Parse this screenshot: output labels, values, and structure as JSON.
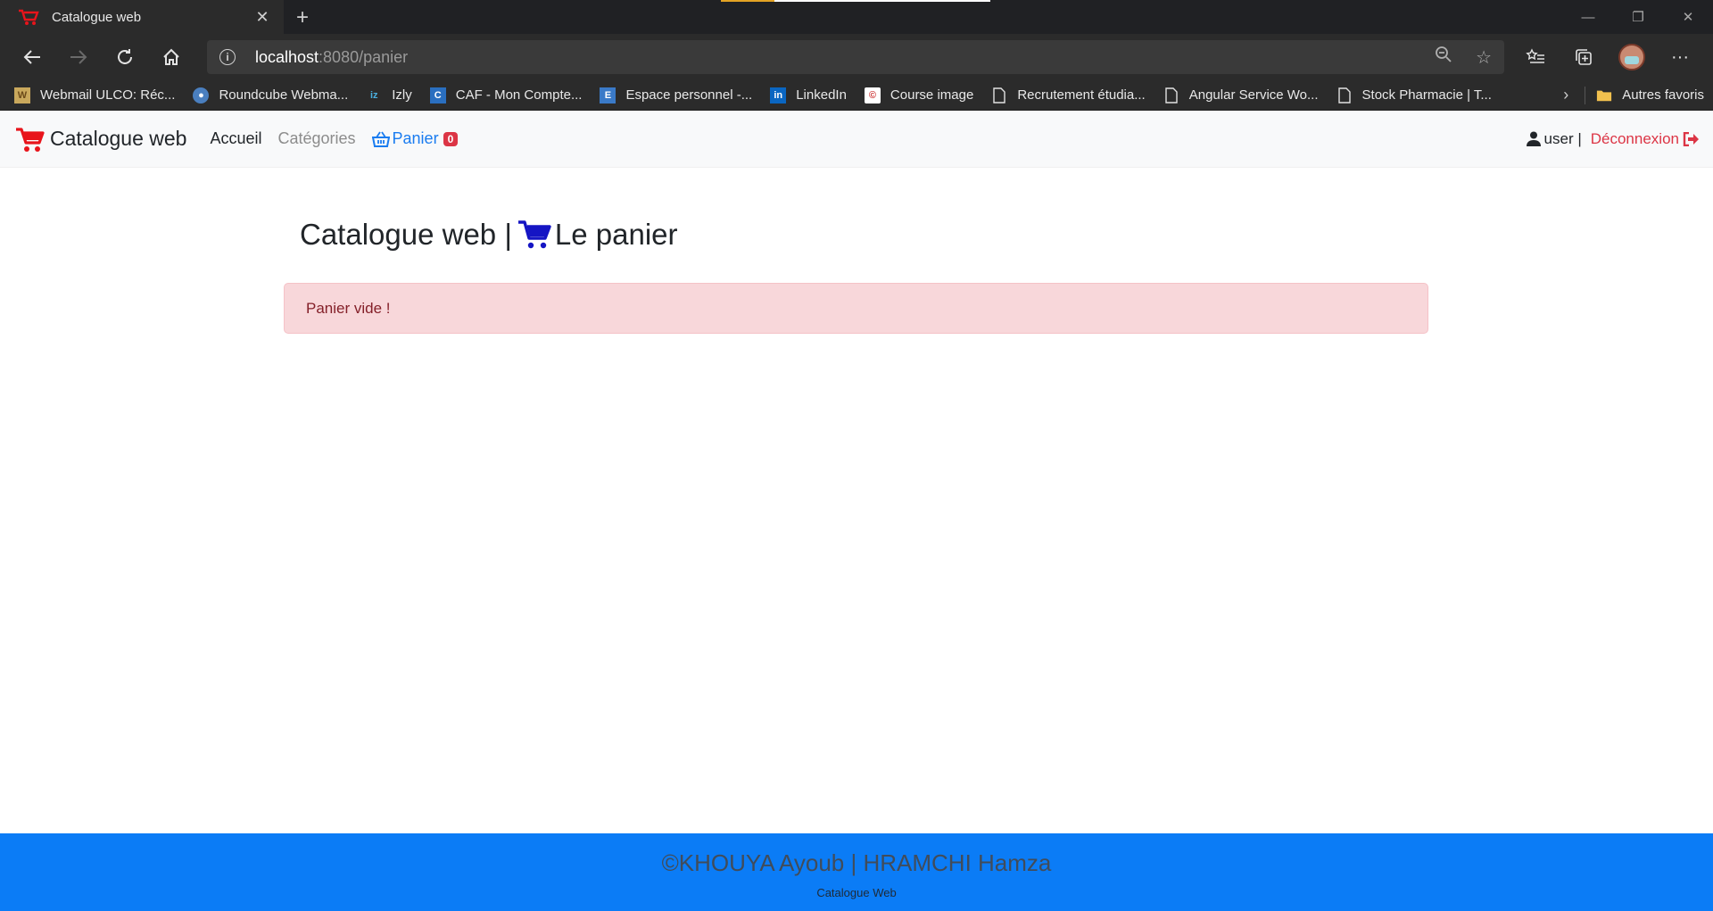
{
  "browser": {
    "tab_title": "Catalogue web",
    "url_host": "localhost",
    "url_rest": ":8080/panier",
    "bookmarks": [
      "Webmail ULCO: Réc...",
      "Roundcube Webma...",
      "Izly",
      "CAF - Mon Compte...",
      "Espace personnel -...",
      "LinkedIn",
      "Course image",
      "Recrutement étudia...",
      "Angular Service Wo...",
      "Stock Pharmacie | T..."
    ],
    "other_favorites": "Autres favoris"
  },
  "navbar": {
    "brand": "Catalogue web",
    "home": "Accueil",
    "categories": "Catégories",
    "cart": "Panier",
    "cart_count": "0",
    "user": "user |",
    "logout": "Déconnexion"
  },
  "main": {
    "title_prefix": "Catalogue web |",
    "title_suffix": "Le panier",
    "alert": "Panier vide !"
  },
  "footer": {
    "credit": "©KHOUYA Ayoub | HRAMCHI Hamza",
    "sub": "Catalogue Web"
  },
  "colors": {
    "primary": "#0b7cf6",
    "danger": "#dc3545",
    "brand_cart": "#e8141b",
    "title_cart": "#1515c4"
  }
}
